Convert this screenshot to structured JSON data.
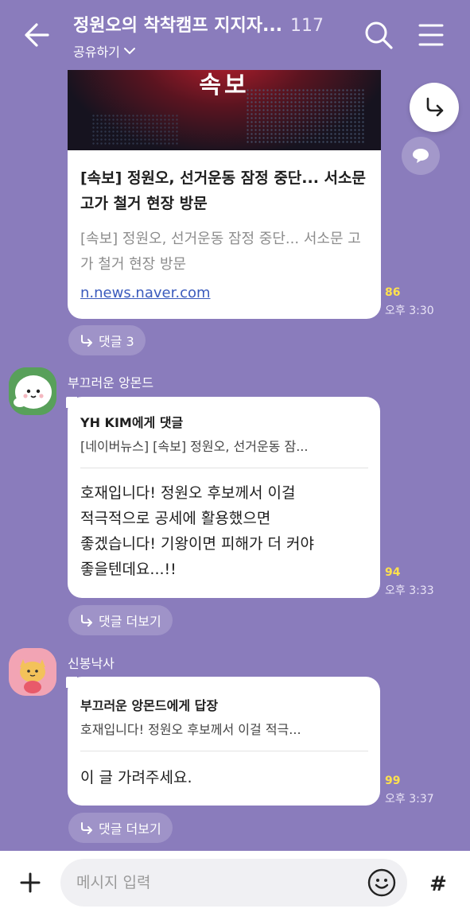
{
  "header": {
    "title": "정원오의 착착캠프 지지자...",
    "member_count": "117",
    "share_label": "공유하기"
  },
  "news": {
    "image_caption": "속보",
    "headline": "[속보] 정원오, 선거운동 잠정 중단... 서소문 고가 철거 현장 방문",
    "description": "[속보] 정원오, 선거운동 잠정 중단... 서소문 고가 철거 현장 방문",
    "link": "n.news.naver.com",
    "unread": "86",
    "time": "오후 3:30",
    "reply_label": "댓글 3"
  },
  "messages": [
    {
      "sender": "부끄러운 앙몬드",
      "avatar": "white-blob-character",
      "quote_to": "YH KIM에게 댓글",
      "quote_text": "[네이버뉴스] [속보] 정원오, 선거운동 잠...",
      "lines": [
        "호재입니다! 정원오 후보께서 이걸",
        "적극적으로 공세에 활용했으면",
        "좋겠습니다! 기왕이면 피해가 더 커야",
        "좋을텐데요...!!"
      ],
      "unread": "94",
      "time": "오후 3:33",
      "reply_label": "댓글 더보기"
    },
    {
      "sender": "신봉낙사",
      "avatar": "yellow-cat-character",
      "quote_to": "부끄러운 앙몬드에게 답장",
      "quote_text": "호재입니다! 정원오 후보께서 이걸 적극...",
      "lines": [
        "이 글 가려주세요."
      ],
      "unread": "99",
      "time": "오후 3:37",
      "reply_label": "댓글 더보기"
    }
  ],
  "input": {
    "placeholder": "메시지 입력",
    "hash_label": "#"
  },
  "colors": {
    "background": "#8a7cbc",
    "unread": "#ffe14d",
    "link": "#3b5bbd"
  },
  "icons": [
    "back-arrow-icon",
    "chevron-down-icon",
    "search-icon",
    "menu-icon",
    "share-arrow-icon",
    "comment-icon",
    "reply-arrow-icon",
    "plus-icon",
    "emoji-icon",
    "hash-icon"
  ]
}
